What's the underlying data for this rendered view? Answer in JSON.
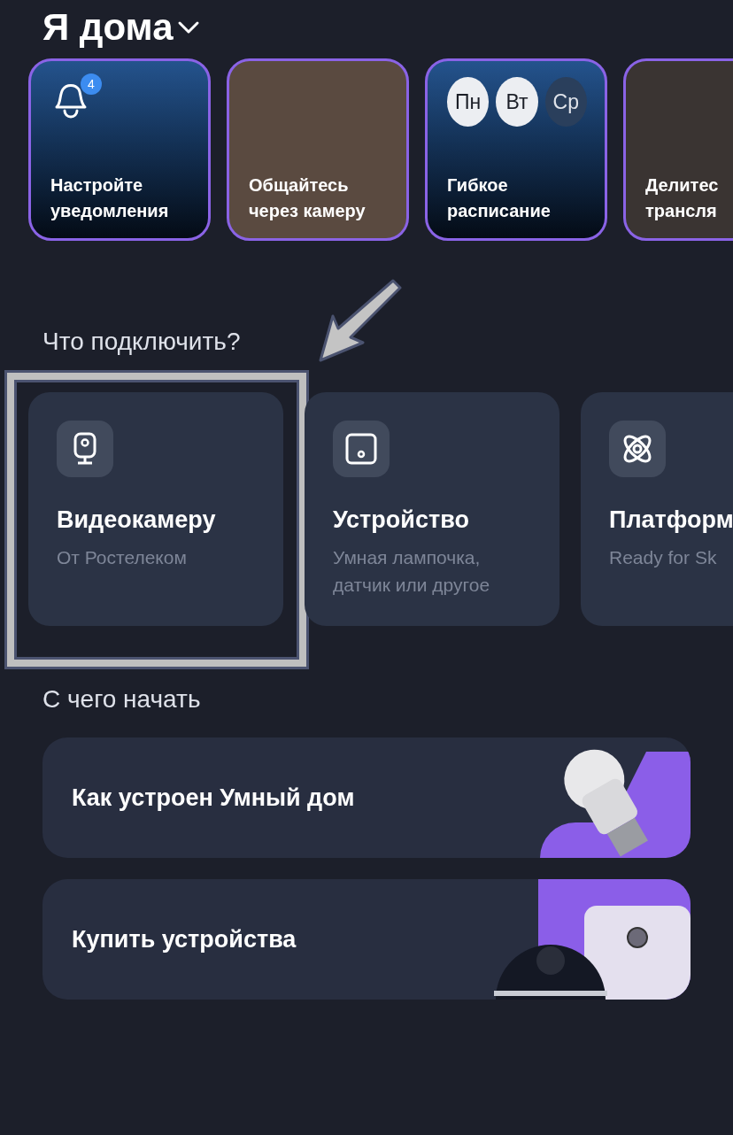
{
  "header": {
    "title": "Я дома"
  },
  "stories": [
    {
      "kind": "bell",
      "badge": "4",
      "lines": [
        "Настройте",
        "уведомления"
      ]
    },
    {
      "kind": "photo",
      "lines": [
        "Общайтесь",
        "через камеру"
      ]
    },
    {
      "kind": "days",
      "days": [
        {
          "label": "Пн",
          "selected": true
        },
        {
          "label": "Вт",
          "selected": true
        },
        {
          "label": "Ср",
          "selected": false
        }
      ],
      "lines": [
        "Гибкое",
        "расписание"
      ]
    },
    {
      "kind": "photo",
      "lines": [
        "Делитес",
        "трансля"
      ]
    }
  ],
  "connect": {
    "heading": "Что подключить?",
    "items": [
      {
        "kind": "camera",
        "title": "Видеокамеру",
        "subtitle": "От Ростелеком",
        "highlighted": true
      },
      {
        "kind": "device",
        "title": "Устройство",
        "subtitle": "Умная лампочка, датчик или другое",
        "highlighted": false
      },
      {
        "kind": "atom",
        "title": "Платформ",
        "subtitle": "Ready for Sk",
        "highlighted": false
      }
    ]
  },
  "start": {
    "heading": "С чего начать",
    "items": [
      {
        "kind": "bulb",
        "title": "Как устроен Умный дом"
      },
      {
        "kind": "devices",
        "title": "Купить устройства"
      }
    ]
  }
}
